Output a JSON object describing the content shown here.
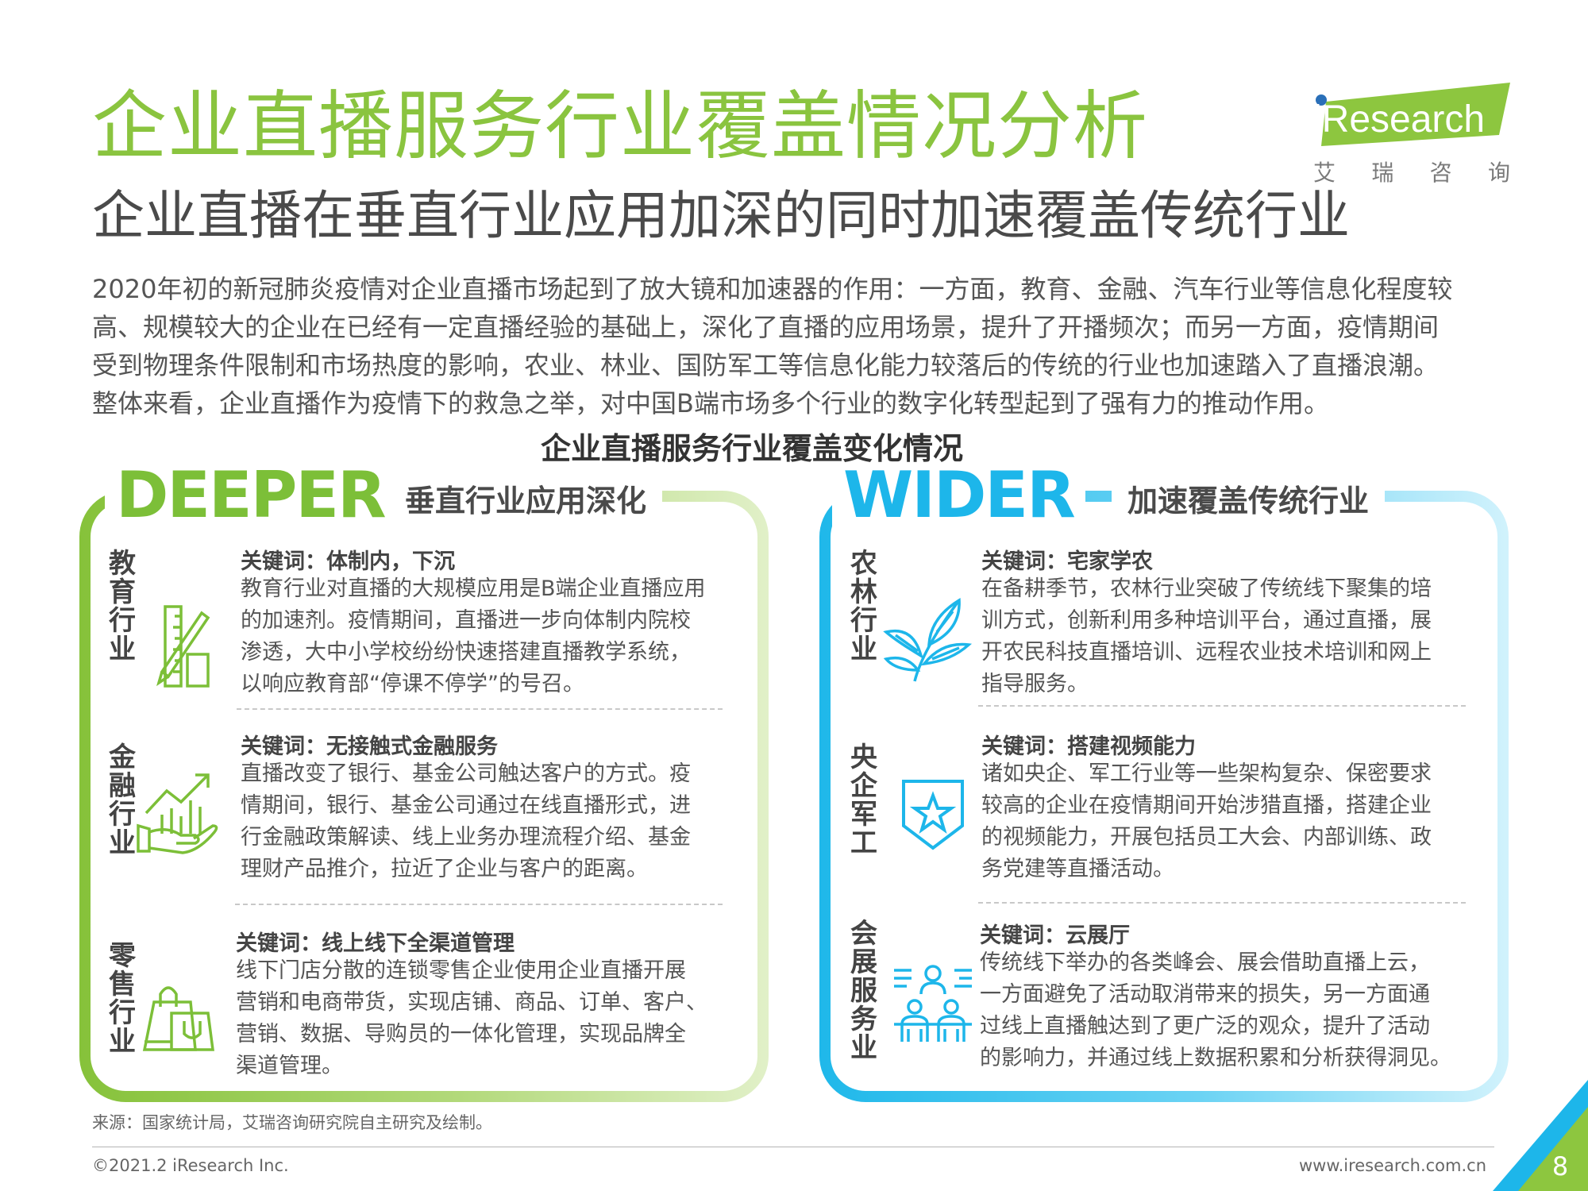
{
  "header": {
    "title": "企业直播服务行业覆盖情况分析",
    "subtitle": "企业直播在垂直行业应用加深的同时加速覆盖传统行业",
    "intro_lines": [
      "2020年初的新冠肺炎疫情对企业直播市场起到了放大镜和加速器的作用：一方面，教育、金融、汽车行业等信息化程度较",
      "高、规模较大的企业在已经有一定直播经验的基础上，深化了直播的应用场景，提升了开播频次；而另一方面，疫情期间",
      "受到物理条件限制和市场热度的影响，农业、林业、国防军工等信息化能力较落后的传统的行业也加速踏入了直播浪潮。",
      "整体来看，企业直播作为疫情下的救急之举，对中国B端市场多个行业的数字化转型起到了强有力的推动作用。"
    ],
    "section_title": "企业直播服务行业覆盖变化情况"
  },
  "logo": {
    "word_prefix": "i",
    "word": "Research",
    "chars": [
      "艾",
      "瑞",
      "咨",
      "询"
    ],
    "green": "#8dc63f",
    "blue": "#2a6fb8"
  },
  "left_panel": {
    "big_word": "DEEPER",
    "label": "垂直行业应用深化",
    "color": "#7cbf38",
    "items": [
      {
        "industry": "教育行业",
        "icon": "ruler-pencil-icon",
        "keyword": "关键词：体制内，下沉",
        "lines": [
          "教育行业对直播的大规模应用是B端企业直播应用",
          "的加速剂。疫情期间，直播进一步向体制内院校",
          "渗透，大中小学校纷纷快速搭建直播教学系统，",
          "以响应教育部“停课不停学”的号召。"
        ]
      },
      {
        "industry": "金融行业",
        "icon": "finance-growth-icon",
        "keyword": "关键词：无接触式金融服务",
        "lines": [
          "直播改变了银行、基金公司触达客户的方式。疫",
          "情期间，银行、基金公司通过在线直播形式，进",
          "行金融政策解读、线上业务办理流程介绍、基金",
          "理财产品推介，拉近了企业与客户的距离。"
        ]
      },
      {
        "industry": "零售行业",
        "icon": "shopping-bag-icon",
        "keyword": "关键词：线上线下全渠道管理",
        "lines": [
          "线下门店分散的连锁零售企业使用企业直播开展",
          "营销和电商带货，实现店铺、商品、订单、客户、",
          "营销、数据、导购员的一体化管理，实现品牌全",
          "渠道管理。"
        ]
      }
    ]
  },
  "right_panel": {
    "big_word": "WIDER",
    "label": "加速覆盖传统行业",
    "color": "#1db6ea",
    "items": [
      {
        "industry": "农林行业",
        "icon": "plant-leaf-icon",
        "keyword": "关键词：宅家学农",
        "lines": [
          "在备耕季节，农林行业突破了传统线下聚集的培",
          "训方式，创新利用多种培训平台，通过直播，展",
          "开农民科技直播培训、远程农业技术培训和网上",
          "指导服务。"
        ]
      },
      {
        "industry": "央企军工",
        "icon": "star-shield-icon",
        "keyword": "关键词：搭建视频能力",
        "lines": [
          "诸如央企、军工行业等一些架构复杂、保密要求",
          "较高的企业在疫情期间开始涉猎直播，搭建企业",
          "的视频能力，开展包括员工大会、内部训练、政",
          "务党建等直播活动。"
        ]
      },
      {
        "industry": "会展服务业",
        "icon": "conference-people-icon",
        "keyword": "关键词：云展厅",
        "lines": [
          "传统线下举办的各类峰会、展会借助直播上云，",
          "一方面避免了活动取消带来的损失，另一方面通",
          "过线上直播触达到了更广泛的观众，提升了活动",
          "的影响力，并通过线上数据积累和分析获得洞见。"
        ]
      }
    ]
  },
  "footer": {
    "source": "来源：国家统计局，艾瑞咨询研究院自主研究及绘制。",
    "copyright": "©2021.2 iResearch Inc.",
    "website": "www.iresearch.com.cn",
    "page_number": "8"
  }
}
